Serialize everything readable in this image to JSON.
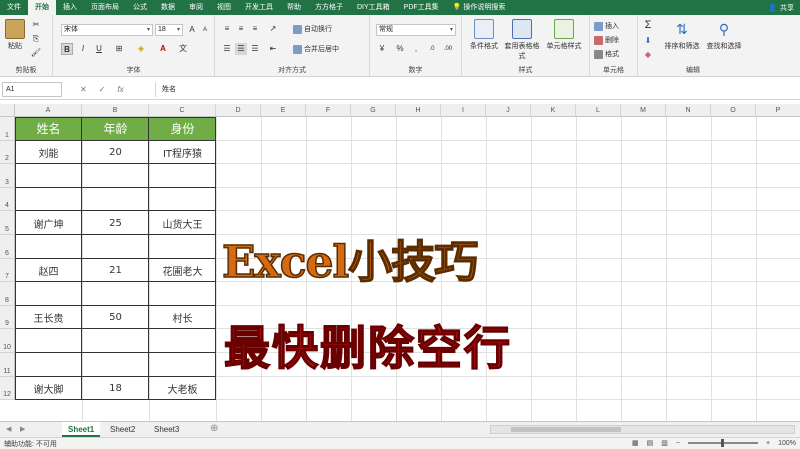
{
  "menu": {
    "tabs": [
      "文件",
      "开始",
      "插入",
      "页面布局",
      "公式",
      "数据",
      "审阅",
      "视图",
      "开发工具",
      "帮助",
      "方方格子",
      "DIY工具箱",
      "PDF工具集",
      "操作说明搜索"
    ],
    "share": "共享"
  },
  "ribbon": {
    "clipboard": {
      "paste": "粘贴",
      "label": "剪贴板"
    },
    "font": {
      "name": "宋体",
      "size": "18",
      "bold": "B",
      "italic": "I",
      "underline": "U",
      "label": "字体"
    },
    "alignment": {
      "wrap": "自动换行",
      "merge": "合并后居中",
      "label": "对齐方式"
    },
    "number": {
      "format": "常规",
      "label": "数字"
    },
    "styles": {
      "conditional": "条件格式",
      "table": "套用表格格式",
      "cell": "单元格样式",
      "label": "样式"
    },
    "cells": {
      "insert": "插入",
      "delete": "删除",
      "format": "格式",
      "label": "单元格"
    },
    "editing": {
      "sort": "排序和筛选",
      "find": "查找和选择",
      "label": "编辑"
    }
  },
  "formula_bar": {
    "name_box": "A1",
    "content": "姓名"
  },
  "grid": {
    "columns": [
      "A",
      "B",
      "C",
      "D",
      "E",
      "F",
      "G",
      "H",
      "I",
      "J",
      "K",
      "L",
      "M",
      "N",
      "O",
      "P"
    ],
    "rows": [
      "1",
      "2",
      "3",
      "4",
      "5",
      "6",
      "7",
      "8",
      "9",
      "10",
      "11",
      "12"
    ],
    "headers": [
      "姓名",
      "年龄",
      "身份"
    ],
    "data": [
      [
        "刘能",
        "20",
        "IT程序猿"
      ],
      [
        "",
        "",
        ""
      ],
      [
        "",
        "",
        ""
      ],
      [
        "谢广坤",
        "25",
        "山货大王"
      ],
      [
        "",
        "",
        ""
      ],
      [
        "赵四",
        "21",
        "花圃老大"
      ],
      [
        "",
        "",
        ""
      ],
      [
        "王长贵",
        "50",
        "村长"
      ],
      [
        "",
        "",
        ""
      ],
      [
        "",
        "",
        ""
      ],
      [
        "谢大脚",
        "18",
        "大老板"
      ]
    ],
    "header_color": "#70ad47"
  },
  "overlay": {
    "line1": "Excel小技巧",
    "line2": "最快删除空行",
    "line1_color": "#d46b12",
    "line2_color": "#e01818"
  },
  "sheets": [
    "Sheet1",
    "Sheet2",
    "Sheet3"
  ],
  "status": {
    "accessibility": "辅助功能: 不可用",
    "zoom": "100%"
  }
}
